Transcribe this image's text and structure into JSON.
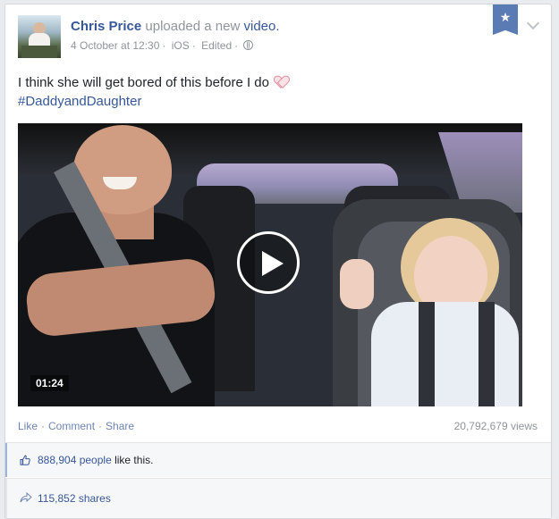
{
  "post": {
    "author": "Chris Price",
    "action": "uploaded a new",
    "object": "video.",
    "timestamp": "4 October at 12:30",
    "source": "iOS",
    "edited": "Edited",
    "privacy_icon": "globe-icon",
    "status_text": "I think she will get bored of this before I do",
    "status_emoji": "heart-icon",
    "hashtag": "#DaddyandDaughter",
    "bookmark_icon": "star-icon"
  },
  "video": {
    "duration": "01:24",
    "play_icon": "play-icon"
  },
  "actions": {
    "like": "Like",
    "comment": "Comment",
    "share": "Share",
    "separator": "·",
    "views": "20,792,679 views"
  },
  "social": {
    "likes_count": "888,904 people",
    "likes_suffix": "like this.",
    "shares": "115,852 shares"
  },
  "colors": {
    "link": "#365899",
    "bookmark": "#5b7bb5",
    "meta": "#90949c"
  }
}
